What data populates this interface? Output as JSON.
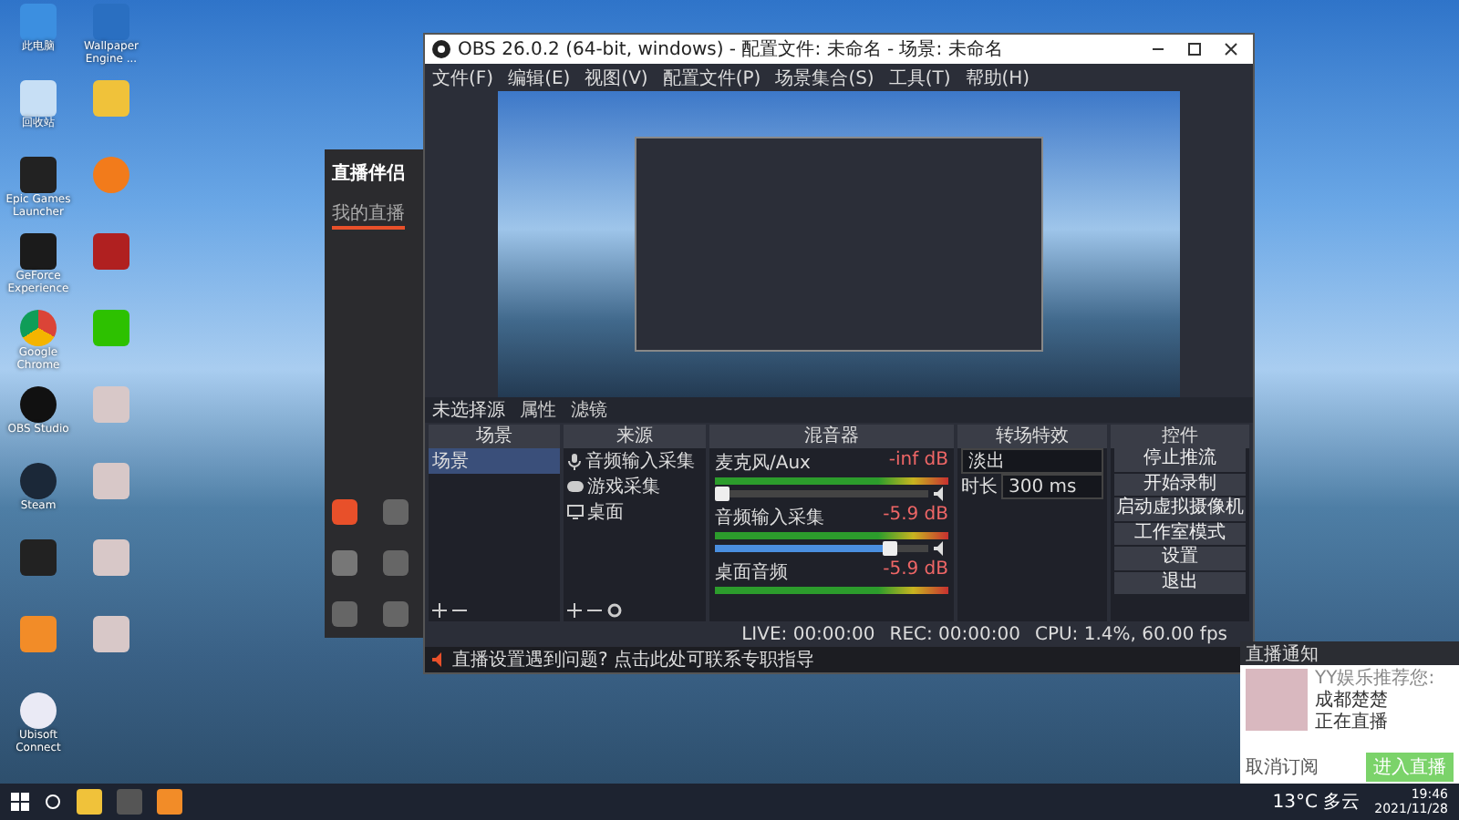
{
  "desktop_icons": [
    {
      "label": "此电脑",
      "kind": "pc"
    },
    {
      "label": "Wallpaper Engine ...",
      "kind": "wallpaper"
    },
    {
      "label": "回收站",
      "kind": "bin"
    },
    {
      "kind": "mascot"
    },
    {
      "label": "Epic Games Launcher",
      "kind": "epic"
    },
    {
      "kind": "orange"
    },
    {
      "label": "GeForce Experience",
      "kind": "nvidia"
    },
    {
      "kind": "red"
    },
    {
      "label": "Google Chrome",
      "kind": "chrome"
    },
    {
      "kind": "wechat"
    },
    {
      "label": "OBS Studio",
      "kind": "obs"
    },
    {
      "kind": "photo"
    },
    {
      "label": "Steam",
      "kind": "steam"
    },
    {
      "kind": "photo"
    },
    {
      "kind": "ggame"
    },
    {
      "kind": "photo"
    },
    {
      "kind": "orangeapp"
    },
    {
      "kind": "photo"
    },
    {
      "label": "Ubisoft Connect",
      "kind": "ubisoft"
    }
  ],
  "companion_app": {
    "title": "直播伴侣",
    "tab": "我的直播"
  },
  "obs": {
    "title": "OBS 26.0.2 (64-bit, windows) - 配置文件: 未命名 - 场景: 未命名",
    "menu": [
      "文件(F)",
      "编辑(E)",
      "视图(V)",
      "配置文件(P)",
      "场景集合(S)",
      "工具(T)",
      "帮助(H)"
    ],
    "source_bar": {
      "label": "未选择源",
      "buttons": [
        "属性",
        "滤镜"
      ]
    },
    "docks": {
      "scenes": "场景",
      "sources": "来源",
      "mixer": "混音器",
      "transitions": "转场特效",
      "controls": "控件"
    },
    "scenes": [
      {
        "name": "场景",
        "selected": true
      }
    ],
    "sources": [
      {
        "name": "音频输入采集",
        "kind": "mic"
      },
      {
        "name": "游戏采集",
        "kind": "game"
      },
      {
        "name": "桌面",
        "kind": "monitor"
      }
    ],
    "mixer": [
      {
        "name": "麦克风/Aux",
        "reading": "-inf dB",
        "level": 0.03
      },
      {
        "name": "音频输入采集",
        "reading": "-5.9 dB",
        "level": 0.82
      },
      {
        "name": "桌面音频",
        "reading": "-5.9 dB"
      }
    ],
    "transition": {
      "value": "淡出",
      "duration_label": "时长",
      "duration": "300 ms"
    },
    "controls": [
      "停止推流",
      "开始录制",
      "启动虚拟摄像机",
      "工作室模式",
      "设置",
      "退出"
    ],
    "status": {
      "live": "LIVE: 00:00:00",
      "rec": "REC: 00:00:00",
      "cpu": "CPU: 1.4%, 60.00 fps"
    },
    "notice": "直播设置遇到问题? 点击此处可联系专职指导"
  },
  "notification": {
    "title": "直播通知",
    "line": "YY娱乐推荐您:",
    "name": "成都楚楚",
    "status": "正在直播",
    "dismiss": "取消订阅",
    "action": "进入直播"
  },
  "taskbar": {
    "weather": "13°C 多云",
    "time": "19:46",
    "date": "2021/11/28"
  }
}
